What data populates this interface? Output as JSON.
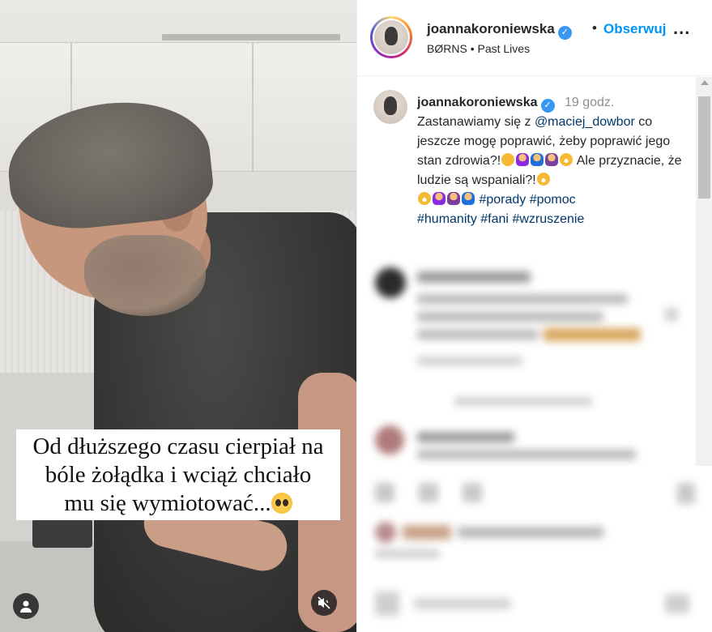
{
  "video": {
    "caption_line1": "Od dłuższego czasu cierpiał na",
    "caption_line2": "bóle żołądka i wciąż chciało",
    "caption_line3": "mu się wymiotować...",
    "caption_emoji": "pleading-face-icon"
  },
  "post": {
    "username": "joannakoroniewska",
    "verified": true,
    "follow_label": "Obserwuj",
    "more_label": "...",
    "audio_artist": "BØRNS",
    "audio_title": "Past Lives",
    "audio_separator": "•"
  },
  "caption": {
    "username": "joannakoroniewska",
    "time": "19 godz.",
    "text_part1": "Zastanawiamy się z ",
    "mention": "@maciej_dowbor",
    "text_part2": " co jeszcze mogę poprawić, żeby poprawić jego stan zdrowia?!",
    "text_part3": " Ale przyznacie, że ludzie są wspaniali?!",
    "hashtags": [
      "#porady",
      "#pomoc",
      "#humanity",
      "#fani",
      "#wzruszenie"
    ]
  },
  "colors": {
    "accent": "#0095f6",
    "link": "#00376b",
    "verified": "#3897f0",
    "text": "#262626",
    "muted": "#8e8e8e"
  }
}
